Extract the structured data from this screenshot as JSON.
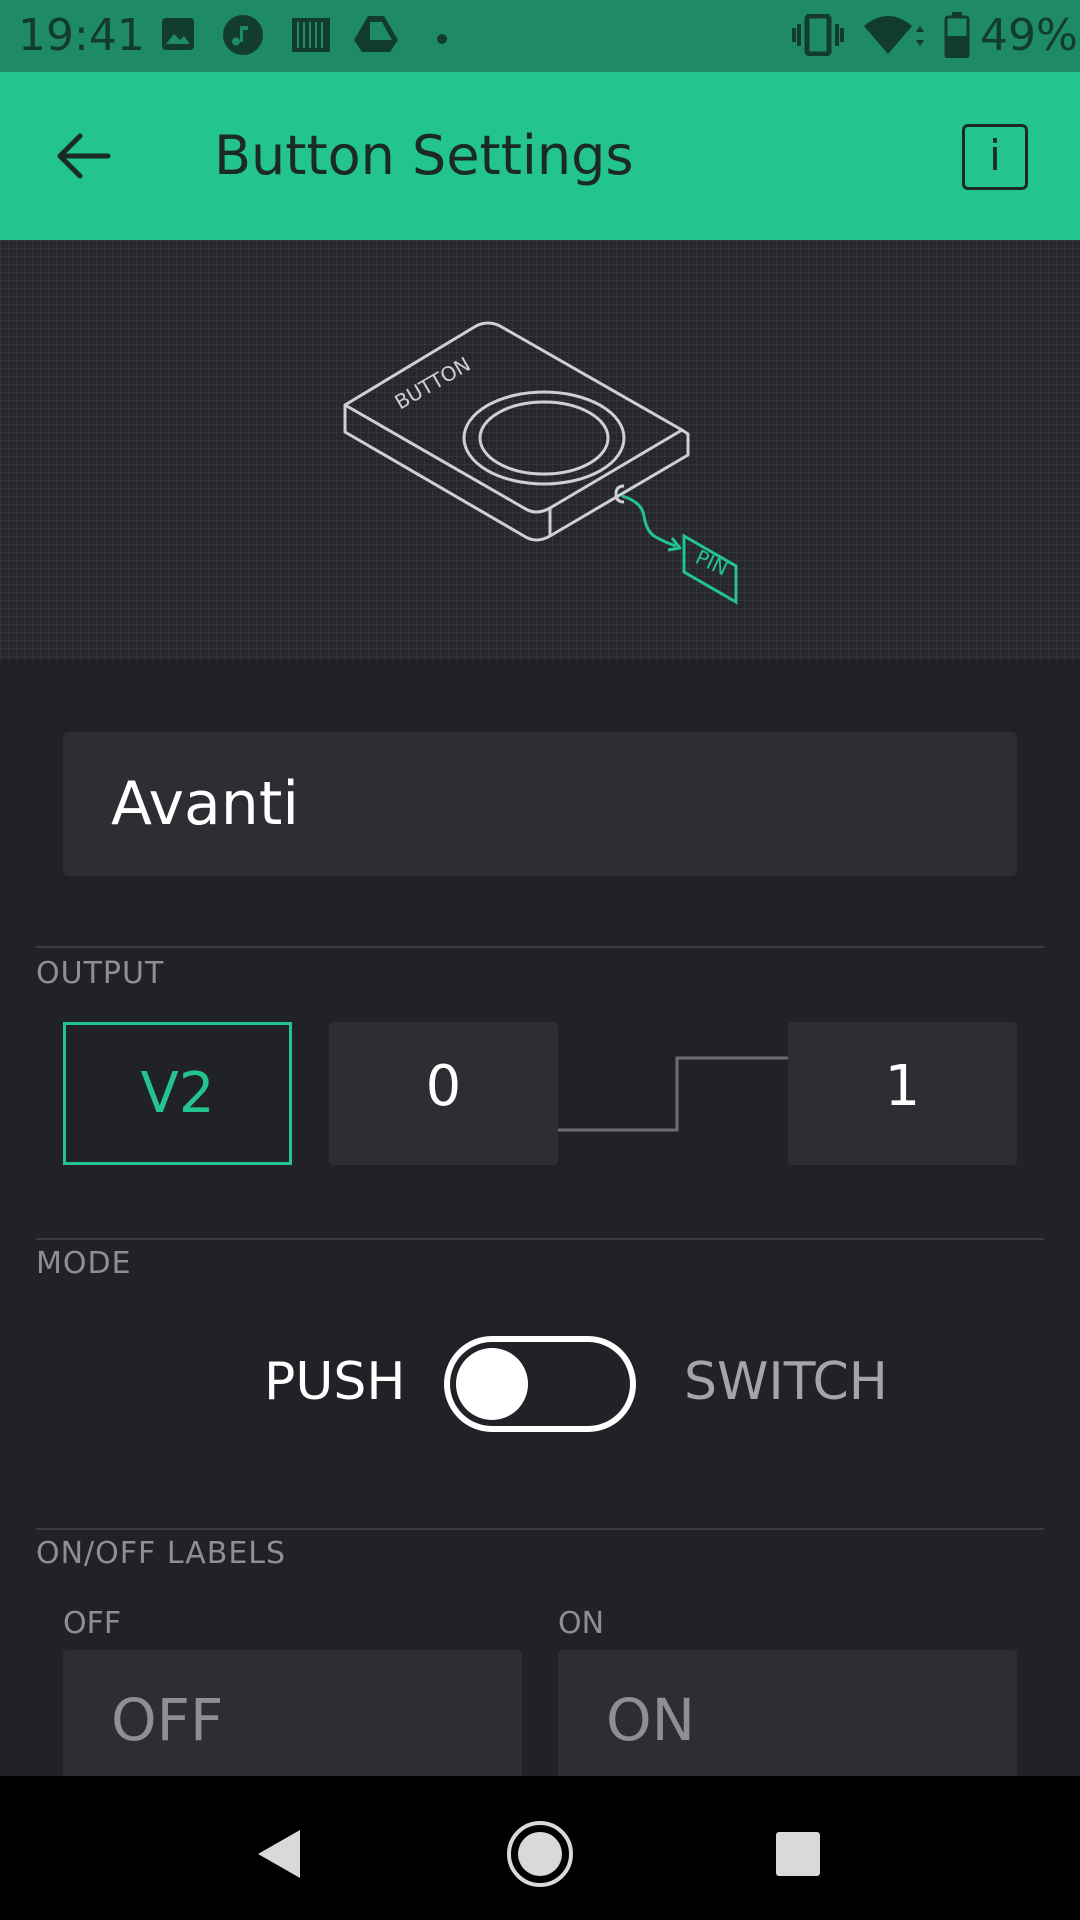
{
  "status_bar": {
    "time": "19:41",
    "battery": "49%",
    "icons": [
      "image-icon",
      "music-icon",
      "barcode-app-icon",
      "drive-icon",
      "dot-icon",
      "vibrate-icon",
      "wifi-icon",
      "battery-icon"
    ]
  },
  "app_bar": {
    "title": "Button Settings",
    "info_label": "i",
    "accent": "#23c48e"
  },
  "illustration": {
    "device_label": "BUTTON",
    "pin_label": "PIN"
  },
  "name_field": {
    "value": "Avanti"
  },
  "output": {
    "section_label": "OUTPUT",
    "pin": "V2",
    "low": "0",
    "high": "1"
  },
  "mode": {
    "section_label": "MODE",
    "left_option": "PUSH",
    "right_option": "SWITCH",
    "selected": "PUSH"
  },
  "labels": {
    "section_label": "ON/OFF LABELS",
    "off_caption": "OFF",
    "on_caption": "ON",
    "off_value": "OFF",
    "on_value": "ON"
  },
  "nav_bar": {
    "icons": [
      "back-icon",
      "home-icon",
      "recents-icon"
    ]
  }
}
